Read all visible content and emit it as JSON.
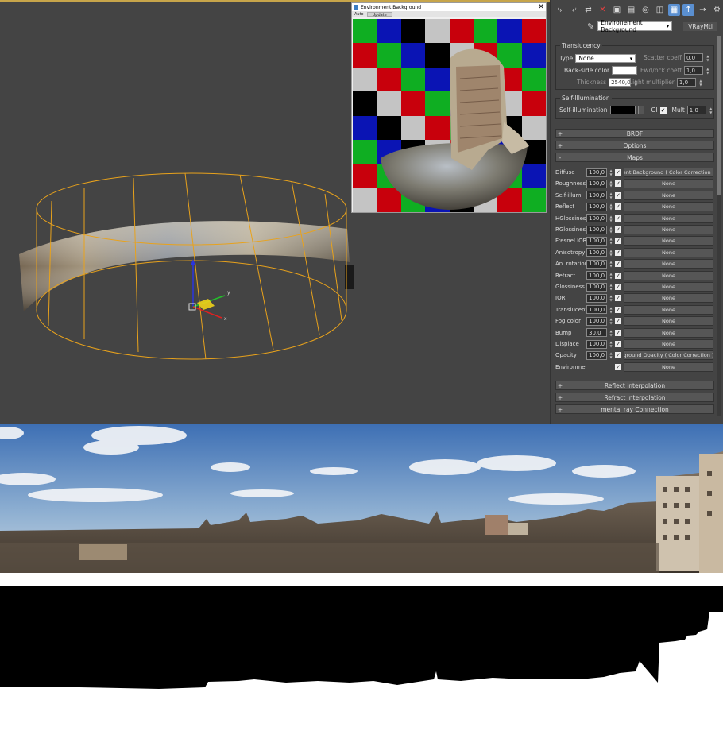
{
  "env_window": {
    "title": "Environment Background",
    "toolbar": [
      "Auto",
      "Update"
    ],
    "checker": [
      [
        "green",
        "blue",
        "black",
        "gray",
        "red",
        "green",
        "blue",
        "red"
      ],
      [
        "red",
        "green",
        "blue",
        "black",
        "gray",
        "red",
        "green",
        "blue"
      ],
      [
        "gray",
        "red",
        "green",
        "blue",
        "black",
        "gray",
        "red",
        "green"
      ],
      [
        "black",
        "gray",
        "red",
        "green",
        "blue",
        "black",
        "gray",
        "red"
      ],
      [
        "blue",
        "black",
        "gray",
        "red",
        "green",
        "blue",
        "black",
        "gray"
      ],
      [
        "green",
        "blue",
        "black",
        "gray",
        "red",
        "green",
        "blue",
        "black"
      ],
      [
        "red",
        "green",
        "blue",
        "black",
        "gray",
        "red",
        "green",
        "blue"
      ],
      [
        "gray",
        "red",
        "green",
        "blue",
        "black",
        "gray",
        "red",
        "green"
      ]
    ],
    "colors": {
      "green": "#0fae22",
      "blue": "#0a14b4",
      "black": "#000000",
      "gray": "#c4c4c4",
      "red": "#c8000c"
    }
  },
  "panel": {
    "toolbar_icons": [
      "pick-material-icon",
      "put-material-icon",
      "assign-material-icon",
      "reset-map-icon",
      "make-unique-icon",
      "put-to-library-icon",
      "material-id-icon",
      "show-map-icon",
      "show-end-result-icon",
      "go-to-parent-icon",
      "go-forward-icon",
      "options-icon"
    ],
    "material_name": "Environement Background",
    "material_type": "VRayMtl",
    "translucency": {
      "title": "Translucency",
      "type_label": "Type",
      "type_value": "None",
      "backside_label": "Back-side color",
      "thickness_label": "Thickness",
      "thickness_value": "2540,0",
      "scatter_label": "Scatter coeff",
      "scatter_value": "0,0",
      "fwdbck_label": "Fwd/bck coeff",
      "fwdbck_value": "1,0",
      "light_label": "Light multiplier",
      "light_value": "1,0"
    },
    "selfillum": {
      "title": "Self-Illumination",
      "label": "Self-illumination",
      "gi_label": "GI",
      "mult_label": "Mult",
      "mult_value": "1,0"
    },
    "rollouts_top": [
      {
        "sign": "+",
        "label": "BRDF"
      },
      {
        "sign": "+",
        "label": "Options"
      },
      {
        "sign": "-",
        "label": "Maps"
      }
    ],
    "maps": [
      {
        "name": "Diffuse",
        "amount": "100,0",
        "checked": true,
        "map": "ent Background  ( Color Correction )"
      },
      {
        "name": "Roughness",
        "amount": "100,0",
        "checked": true,
        "map": "None"
      },
      {
        "name": "Self-illum",
        "amount": "100,0",
        "checked": true,
        "map": "None"
      },
      {
        "name": "Reflect",
        "amount": "100,0",
        "checked": true,
        "map": "None"
      },
      {
        "name": "HGlossiness",
        "amount": "100,0",
        "checked": true,
        "map": "None"
      },
      {
        "name": "RGlossiness",
        "amount": "100,0",
        "checked": true,
        "map": "None"
      },
      {
        "name": "Fresnel IOR",
        "amount": "100,0",
        "checked": true,
        "map": "None"
      },
      {
        "name": "Anisotropy",
        "amount": "100,0",
        "checked": true,
        "map": "None"
      },
      {
        "name": "An. rotation",
        "amount": "100,0",
        "checked": true,
        "map": "None"
      },
      {
        "name": "Refract",
        "amount": "100,0",
        "checked": true,
        "map": "None"
      },
      {
        "name": "Glossiness",
        "amount": "100,0",
        "checked": true,
        "map": "None"
      },
      {
        "name": "IOR",
        "amount": "100,0",
        "checked": true,
        "map": "None"
      },
      {
        "name": "Translucent",
        "amount": "100,0",
        "checked": true,
        "map": "None"
      },
      {
        "name": "Fog color",
        "amount": "100,0",
        "checked": true,
        "map": "None"
      },
      {
        "name": "Bump",
        "amount": "30,0",
        "checked": true,
        "map": "None"
      },
      {
        "name": "Displace",
        "amount": "100,0",
        "checked": true,
        "map": "None"
      },
      {
        "name": "Opacity",
        "amount": "100,0",
        "checked": true,
        "map": "ground Opacity  ( Color Correction )"
      },
      {
        "name": "Environment",
        "amount": "",
        "checked": true,
        "map": "None"
      }
    ],
    "rollouts_bottom": [
      {
        "sign": "+",
        "label": "Reflect interpolation"
      },
      {
        "sign": "+",
        "label": "Refract interpolation"
      },
      {
        "sign": "+",
        "label": "mental ray Connection"
      }
    ]
  },
  "viewport": {
    "gizmo_axes": [
      "x",
      "y",
      "z"
    ],
    "accent": "#e8a21c"
  }
}
